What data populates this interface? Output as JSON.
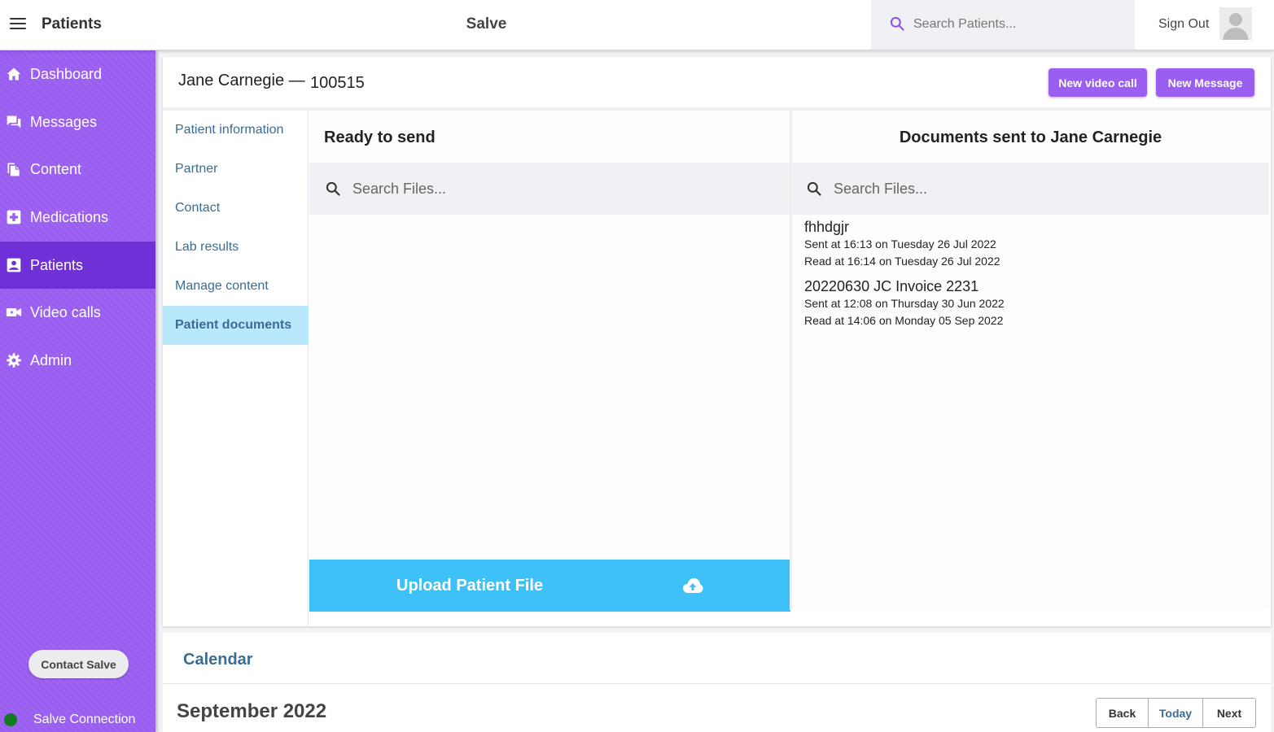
{
  "header": {
    "section_title": "Patients",
    "app_title": "Salve",
    "search_placeholder": "Search Patients...",
    "signout_label": "Sign Out"
  },
  "sidebar": {
    "items": [
      {
        "label": "Dashboard",
        "icon": "home-icon",
        "active": false
      },
      {
        "label": "Messages",
        "icon": "chat-icon",
        "active": false
      },
      {
        "label": "Content",
        "icon": "copy-icon",
        "active": false
      },
      {
        "label": "Medications",
        "icon": "medical-plus-icon",
        "active": false
      },
      {
        "label": "Patients",
        "icon": "contact-card-icon",
        "active": true
      },
      {
        "label": "Video calls",
        "icon": "video-camera-icon",
        "active": false
      },
      {
        "label": "Admin",
        "icon": "gear-icon",
        "active": false
      }
    ],
    "contact_button": "Contact Salve",
    "connection_label": "Salve Connection",
    "connection_status_color": "#147a1e"
  },
  "patient": {
    "name": "Jane Carnegie —",
    "id": "100515"
  },
  "actions": {
    "video_call": "New video call",
    "message": "New Message"
  },
  "subnav": {
    "items": [
      {
        "label": "Patient information",
        "active": false
      },
      {
        "label": "Partner",
        "active": false
      },
      {
        "label": "Contact",
        "active": false
      },
      {
        "label": "Lab results",
        "active": false
      },
      {
        "label": "Manage content",
        "active": false
      },
      {
        "label": "Patient documents",
        "active": true
      }
    ]
  },
  "ready_panel": {
    "title": "Ready to send",
    "search_placeholder": "Search Files...",
    "upload_label": "Upload Patient File"
  },
  "sent_panel": {
    "title": "Documents sent to Jane Carnegie",
    "search_placeholder": "Search Files...",
    "documents": [
      {
        "name": "fhhdgjr",
        "sent": "Sent at 16:13 on Tuesday 26 Jul 2022",
        "read": "Read at 16:14 on Tuesday 26 Jul 2022"
      },
      {
        "name": "20220630 JC Invoice 2231",
        "sent": "Sent at 12:08 on Thursday 30 Jun 2022",
        "read": "Read at 14:06 on Monday 05 Sep 2022"
      }
    ]
  },
  "calendar": {
    "title": "Calendar",
    "month": "September 2022",
    "back_label": "Back",
    "today_label": "Today",
    "next_label": "Next"
  },
  "colors": {
    "brand_purple": "#9a5ef0",
    "active_purple": "#6f30d8",
    "upload_blue": "#3ec1f7",
    "link_blue": "#3b6c94",
    "subnav_active_bg": "#b9e7fb"
  }
}
